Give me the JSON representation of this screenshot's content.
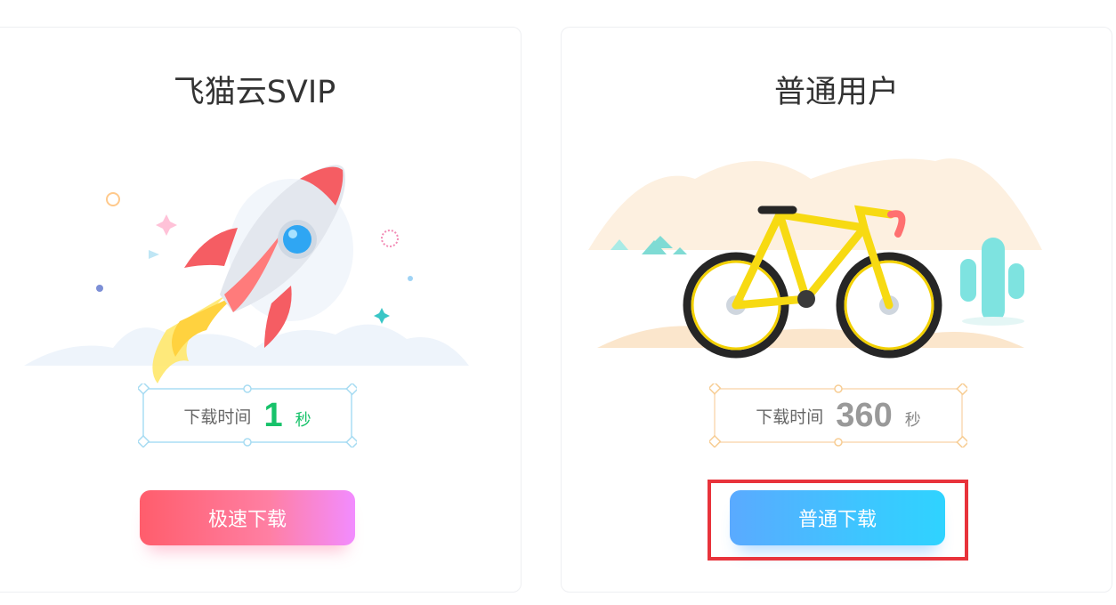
{
  "svip_card": {
    "title": "飞猫云SVIP",
    "time_label": "下载时间",
    "time_value": "1",
    "time_unit": "秒",
    "button_label": "极速下载"
  },
  "normal_card": {
    "title": "普通用户",
    "time_label": "下载时间",
    "time_value": "360",
    "time_unit": "秒",
    "button_label": "普通下载"
  },
  "colors": {
    "svip_time": "#17c26a",
    "normal_time": "#999999",
    "highlight_border": "#e8333b"
  },
  "icons": {
    "svip_illustration": "rocket-icon",
    "normal_illustration": "bicycle-icon"
  }
}
